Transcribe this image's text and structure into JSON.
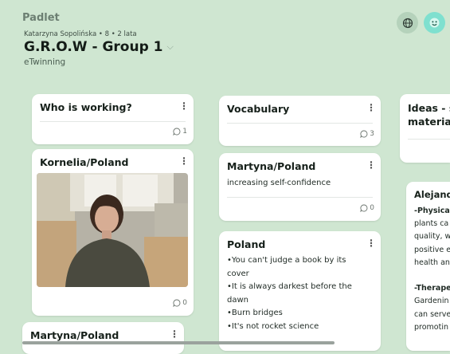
{
  "app": {
    "name": "Padlet"
  },
  "board": {
    "meta": "Katarzyna Sopolińska • 8 • 2 lata",
    "title": "G.R.O.W - Group 1",
    "subtitle": "eTwinning"
  },
  "colors": {
    "background": "#cfe6d1",
    "card": "#ffffff",
    "avatar": "#7fe0cf"
  },
  "posts": {
    "who": {
      "title": "Who is working?",
      "comments": "1"
    },
    "kornelia": {
      "title": "Kornelia/Poland",
      "comments": "0"
    },
    "martyna_bottom": {
      "title": "Martyna/Poland"
    },
    "vocabulary": {
      "title": "Vocabulary",
      "comments": "3"
    },
    "martyna": {
      "title": "Martyna/Poland",
      "body": "increasing self-confidence",
      "comments": "0"
    },
    "poland": {
      "title": "Poland",
      "lines": [
        "•You can't judge a book by its",
        "cover",
        "•It is always darkest before the",
        "dawn",
        "•Burn bridges",
        "•It's not rocket science"
      ]
    },
    "ideas": {
      "title_line1": "Ideas - s",
      "title_line2": "materials"
    },
    "alejandro": {
      "title": "Alejand",
      "lines": [
        "-Physica",
        "plants ca",
        "quality, w",
        "positive e",
        "health an",
        "",
        "-Therape",
        "Gardenin",
        "can serve",
        "promotin"
      ]
    }
  }
}
